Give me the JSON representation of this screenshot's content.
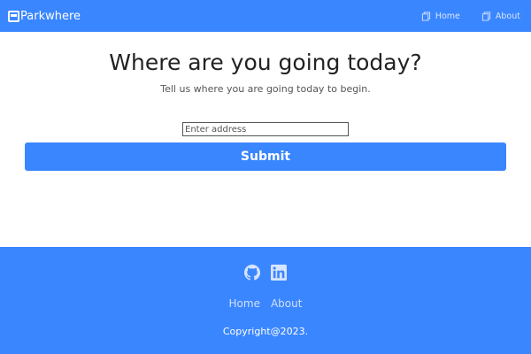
{
  "navbar": {
    "brand": "Parkwhere",
    "links": [
      {
        "label": "Home",
        "icon": "document-icon"
      },
      {
        "label": "About",
        "icon": "document-icon"
      }
    ]
  },
  "main": {
    "title": "Where are you going today?",
    "subtitle": "Tell us where you are going today to begin.",
    "address_placeholder": "Enter address",
    "address_value": "",
    "submit_label": "Submit"
  },
  "footer": {
    "social": [
      {
        "icon": "github-icon"
      },
      {
        "icon": "linkedin-icon"
      }
    ],
    "links": [
      "Home",
      "About"
    ],
    "copyright": "Copyright@2023."
  },
  "colors": {
    "primary": "#3a86ff",
    "nav_link": "#d8e6ff",
    "footer_link": "#cfe0ff"
  }
}
